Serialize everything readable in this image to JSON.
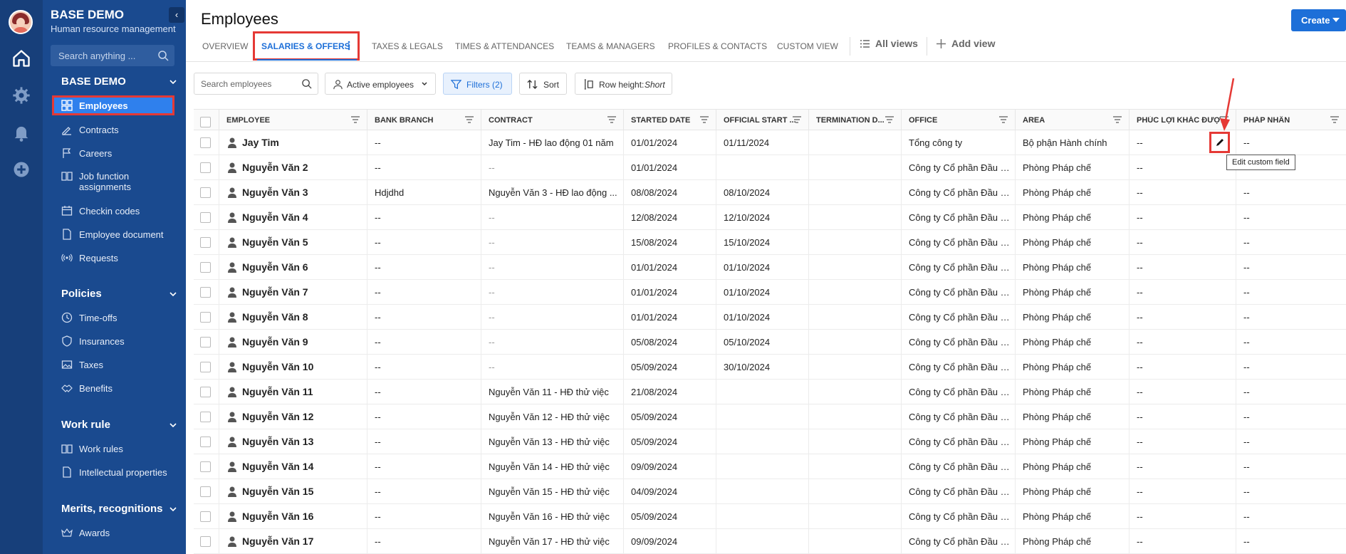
{
  "app": {
    "company": "BASE DEMO",
    "subtitle": "Human resource management"
  },
  "colors": {
    "sidebar": "#1a4a8f",
    "rail": "#173f7a",
    "accent": "#1d6fd8",
    "highlight": "#e53935"
  },
  "sidebar": {
    "search_placeholder": "Search anything ...",
    "sections": [
      {
        "title": "BASE DEMO",
        "items": [
          {
            "label": "Employees",
            "icon": "grid-icon",
            "active": true
          },
          {
            "label": "Contracts",
            "icon": "contract-icon"
          },
          {
            "label": "Careers",
            "icon": "flag-icon"
          },
          {
            "label": "Job function assignments",
            "icon": "book-icon"
          },
          {
            "label": "Checkin codes",
            "icon": "calendar-icon"
          },
          {
            "label": "Employee document",
            "icon": "document-icon"
          },
          {
            "label": "Requests",
            "icon": "broadcast-icon"
          }
        ]
      },
      {
        "title": "Policies",
        "items": [
          {
            "label": "Time-offs",
            "icon": "clock-icon"
          },
          {
            "label": "Insurances",
            "icon": "shield-icon"
          },
          {
            "label": "Taxes",
            "icon": "image-icon"
          },
          {
            "label": "Benefits",
            "icon": "handshake-icon"
          }
        ]
      },
      {
        "title": "Work rule",
        "items": [
          {
            "label": "Work rules",
            "icon": "book-icon"
          },
          {
            "label": "Intellectual properties",
            "icon": "document-icon"
          }
        ]
      },
      {
        "title": "Merits, recognitions",
        "items": [
          {
            "label": "Awards",
            "icon": "crown-icon"
          }
        ]
      }
    ]
  },
  "header": {
    "title": "Employees",
    "create_label": "Create"
  },
  "tabs": [
    {
      "label": "OVERVIEW"
    },
    {
      "label": "SALARIES & OFFERS",
      "active": true
    },
    {
      "label": "TAXES & LEGALS"
    },
    {
      "label": "TIMES & ATTENDANCES"
    },
    {
      "label": "TEAMS & MANAGERS"
    },
    {
      "label": "PROFILES & CONTACTS"
    },
    {
      "label": "CUSTOM VIEW"
    }
  ],
  "views": {
    "all_views": "All views",
    "add_view": "Add view"
  },
  "toolbar": {
    "search_placeholder": "Search employees",
    "active_employees": "Active employees",
    "filters": "Filters (2)",
    "sort": "Sort",
    "row_height_label": "Row height:",
    "row_height_value": "Short"
  },
  "table": {
    "columns": [
      "EMPLOYEE",
      "BANK BRANCH",
      "CONTRACT",
      "STARTED DATE",
      "OFFICIAL START ...",
      "TERMINATION D...",
      "OFFICE",
      "AREA",
      "PHÚC LỢI KHÁC ĐƯỢ...",
      "PHÁP NHÂN"
    ],
    "rows": [
      [
        "Jay Tim",
        "--",
        "Jay Tim - HĐ lao động 01 năm",
        "01/01/2024",
        "01/11/2024",
        "",
        "Tổng công ty",
        "Bộ phận Hành chính",
        "--",
        "--"
      ],
      [
        "Nguyễn Văn 2",
        "--",
        "--",
        "01/01/2024",
        "",
        "",
        "Công ty Cổ phần Đầu t...",
        "Phòng Pháp chế",
        "--",
        ""
      ],
      [
        "Nguyễn Văn 3",
        "Hdjdhd",
        "Nguyễn Văn 3 - HĐ lao động ...",
        "08/08/2024",
        "08/10/2024",
        "",
        "Công ty Cổ phần Đầu t...",
        "Phòng Pháp chế",
        "--",
        "--"
      ],
      [
        "Nguyễn Văn 4",
        "--",
        "--",
        "12/08/2024",
        "12/10/2024",
        "",
        "Công ty Cổ phần Đầu t...",
        "Phòng Pháp chế",
        "--",
        "--"
      ],
      [
        "Nguyễn Văn 5",
        "--",
        "--",
        "15/08/2024",
        "15/10/2024",
        "",
        "Công ty Cổ phần Đầu t...",
        "Phòng Pháp chế",
        "--",
        "--"
      ],
      [
        "Nguyễn Văn 6",
        "--",
        "--",
        "01/01/2024",
        "01/10/2024",
        "",
        "Công ty Cổ phần Đầu t...",
        "Phòng Pháp chế",
        "--",
        "--"
      ],
      [
        "Nguyễn Văn 7",
        "--",
        "--",
        "01/01/2024",
        "01/10/2024",
        "",
        "Công ty Cổ phần Đầu t...",
        "Phòng Pháp chế",
        "--",
        "--"
      ],
      [
        "Nguyễn Văn 8",
        "--",
        "--",
        "01/01/2024",
        "01/10/2024",
        "",
        "Công ty Cổ phần Đầu t...",
        "Phòng Pháp chế",
        "--",
        "--"
      ],
      [
        "Nguyễn Văn 9",
        "--",
        "--",
        "05/08/2024",
        "05/10/2024",
        "",
        "Công ty Cổ phần Đầu t...",
        "Phòng Pháp chế",
        "--",
        "--"
      ],
      [
        "Nguyễn Văn 10",
        "--",
        "--",
        "05/09/2024",
        "30/10/2024",
        "",
        "Công ty Cổ phần Đầu t...",
        "Phòng Pháp chế",
        "--",
        "--"
      ],
      [
        "Nguyễn Văn 11",
        "--",
        "Nguyễn Văn 11 - HĐ thử việc",
        "21/08/2024",
        "",
        "",
        "Công ty Cổ phần Đầu t...",
        "Phòng Pháp chế",
        "--",
        "--"
      ],
      [
        "Nguyễn Văn 12",
        "--",
        "Nguyễn Văn 12 - HĐ thử việc",
        "05/09/2024",
        "",
        "",
        "Công ty Cổ phần Đầu t...",
        "Phòng Pháp chế",
        "--",
        "--"
      ],
      [
        "Nguyễn Văn 13",
        "--",
        "Nguyễn Văn 13 - HĐ thử việc",
        "05/09/2024",
        "",
        "",
        "Công ty Cổ phần Đầu t...",
        "Phòng Pháp chế",
        "--",
        "--"
      ],
      [
        "Nguyễn Văn 14",
        "--",
        "Nguyễn Văn 14 - HĐ thử việc",
        "09/09/2024",
        "",
        "",
        "Công ty Cổ phần Đầu t...",
        "Phòng Pháp chế",
        "--",
        "--"
      ],
      [
        "Nguyễn Văn 15",
        "--",
        "Nguyễn Văn 15 - HĐ thử việc",
        "04/09/2024",
        "",
        "",
        "Công ty Cổ phần Đầu t...",
        "Phòng Pháp chế",
        "--",
        "--"
      ],
      [
        "Nguyễn Văn 16",
        "--",
        "Nguyễn Văn 16 - HĐ thử việc",
        "05/09/2024",
        "",
        "",
        "Công ty Cổ phần Đầu t...",
        "Phòng Pháp chế",
        "--",
        "--"
      ],
      [
        "Nguyễn Văn 17",
        "--",
        "Nguyễn Văn 17 - HĐ thử việc",
        "09/09/2024",
        "",
        "",
        "Công ty Cổ phần Đầu t...",
        "Phòng Pháp chế",
        "--",
        "--"
      ]
    ]
  },
  "tooltip": "Edit custom field"
}
